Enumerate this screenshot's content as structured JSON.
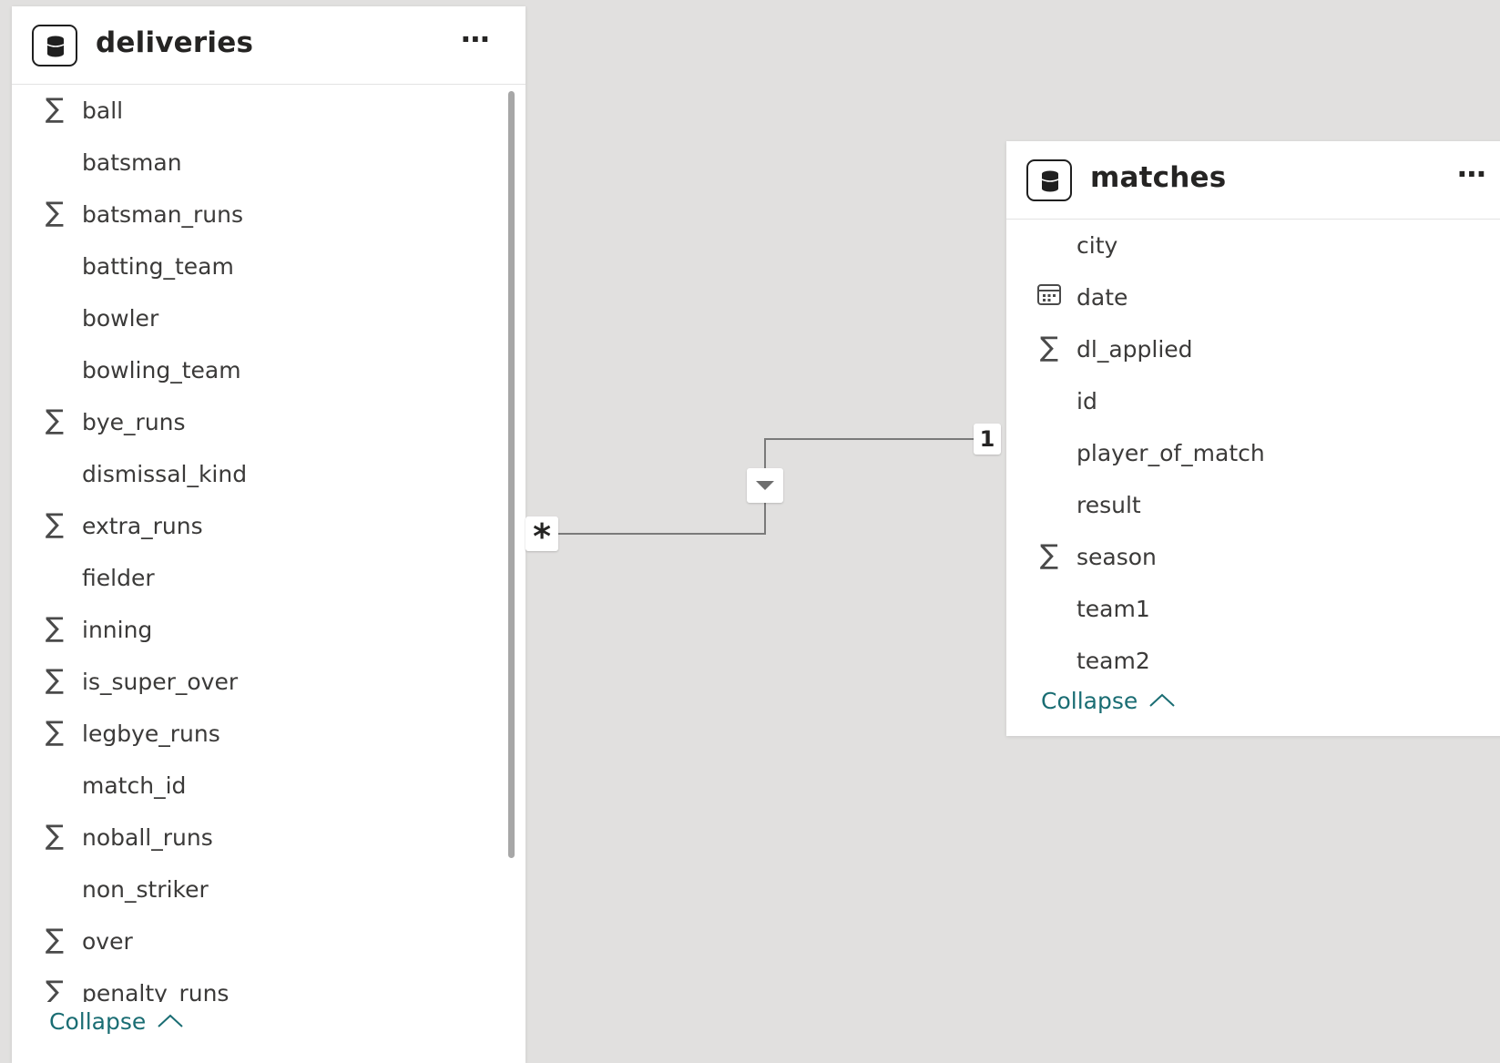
{
  "tables": {
    "deliveries": {
      "title": "deliveries",
      "more_label": "⋯",
      "collapse_label": "Collapse",
      "fields": [
        {
          "name": "ball",
          "icon": "sum-icon",
          "glyph": "∑"
        },
        {
          "name": "batsman",
          "icon": "",
          "glyph": ""
        },
        {
          "name": "batsman_runs",
          "icon": "sum-icon",
          "glyph": "∑"
        },
        {
          "name": "batting_team",
          "icon": "",
          "glyph": ""
        },
        {
          "name": "bowler",
          "icon": "",
          "glyph": ""
        },
        {
          "name": "bowling_team",
          "icon": "",
          "glyph": ""
        },
        {
          "name": "bye_runs",
          "icon": "sum-icon",
          "glyph": "∑"
        },
        {
          "name": "dismissal_kind",
          "icon": "",
          "glyph": ""
        },
        {
          "name": "extra_runs",
          "icon": "sum-icon",
          "glyph": "∑"
        },
        {
          "name": "fielder",
          "icon": "",
          "glyph": ""
        },
        {
          "name": "inning",
          "icon": "sum-icon",
          "glyph": "∑"
        },
        {
          "name": "is_super_over",
          "icon": "sum-icon",
          "glyph": "∑"
        },
        {
          "name": "legbye_runs",
          "icon": "sum-icon",
          "glyph": "∑"
        },
        {
          "name": "match_id",
          "icon": "",
          "glyph": ""
        },
        {
          "name": "noball_runs",
          "icon": "sum-icon",
          "glyph": "∑"
        },
        {
          "name": "non_striker",
          "icon": "",
          "glyph": ""
        },
        {
          "name": "over",
          "icon": "sum-icon",
          "glyph": "∑"
        },
        {
          "name": "penalty_runs",
          "icon": "sum-icon",
          "glyph": "∑"
        }
      ]
    },
    "matches": {
      "title": "matches",
      "more_label": "⋯",
      "collapse_label": "Collapse",
      "fields": [
        {
          "name": "city",
          "icon": "",
          "glyph": ""
        },
        {
          "name": "date",
          "icon": "calendar-icon",
          "glyph": ""
        },
        {
          "name": "dl_applied",
          "icon": "sum-icon",
          "glyph": "∑"
        },
        {
          "name": "id",
          "icon": "",
          "glyph": ""
        },
        {
          "name": "player_of_match",
          "icon": "",
          "glyph": ""
        },
        {
          "name": "result",
          "icon": "",
          "glyph": ""
        },
        {
          "name": "season",
          "icon": "sum-icon",
          "glyph": "∑"
        },
        {
          "name": "team1",
          "icon": "",
          "glyph": ""
        },
        {
          "name": "team2",
          "icon": "",
          "glyph": ""
        }
      ]
    }
  },
  "relationship": {
    "from_cardinality": "*",
    "to_cardinality": "1",
    "filter_direction": "single"
  },
  "colors": {
    "canvas": "#e1e0df",
    "card": "#ffffff",
    "collapse_link": "#1a6d73",
    "line": "#7a7a7a"
  }
}
